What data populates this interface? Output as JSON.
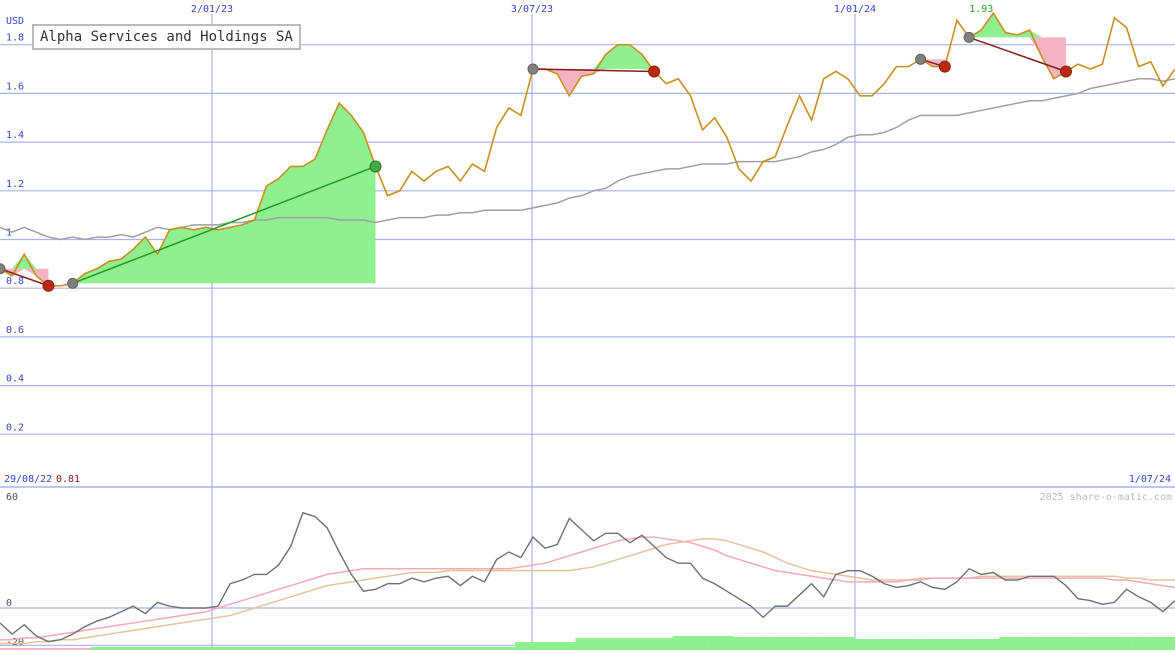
{
  "title": "Alpha Services and Holdings SA",
  "currency": "USD",
  "start_date": "29/08/22",
  "start_price": "0.81",
  "end_date": "1/07/24",
  "peak_label": "1.93",
  "watermark": "2025 share-o-matic.com",
  "colors": {
    "price": "#c8901e",
    "ma": "#a0a0a0",
    "grid": "#a8b4f0",
    "axis_text": "#3344cc",
    "gain_fill": "#90f090",
    "loss_fill": "#f4b4c4",
    "gain_line": "#229922",
    "loss_line": "#8b1a1a",
    "osc": "#707070",
    "osc_pink": "#f4a8b8",
    "osc_tan": "#e4c49c",
    "volume": "#90f090"
  },
  "chart_data": [
    {
      "type": "line",
      "title": "Alpha Services and Holdings SA",
      "ylabel": "USD",
      "ylim": [
        0,
        1.95
      ],
      "y_ticks": [
        "0.2",
        "0.4",
        "0.6",
        "0.8",
        "1",
        "1.2",
        "1.4",
        "1.6",
        "1.8"
      ],
      "x_ticks": [
        "2/01/23",
        "3/07/23",
        "1/01/24"
      ],
      "grid": true,
      "series": [
        {
          "role": "price",
          "values": [
            0.88,
            0.85,
            0.94,
            0.85,
            0.81,
            0.81,
            0.82,
            0.86,
            0.88,
            0.91,
            0.92,
            0.96,
            1.01,
            0.94,
            1.04,
            1.05,
            1.04,
            1.05,
            1.04,
            1.05,
            1.06,
            1.08,
            1.22,
            1.25,
            1.3,
            1.3,
            1.33,
            1.45,
            1.56,
            1.51,
            1.44,
            1.3,
            1.18,
            1.2,
            1.28,
            1.24,
            1.28,
            1.3,
            1.24,
            1.31,
            1.28,
            1.46,
            1.54,
            1.51,
            1.7,
            1.7,
            1.68,
            1.59,
            1.67,
            1.68,
            1.76,
            1.8,
            1.8,
            1.76,
            1.69,
            1.64,
            1.66,
            1.59,
            1.45,
            1.5,
            1.42,
            1.29,
            1.24,
            1.32,
            1.34,
            1.47,
            1.59,
            1.49,
            1.66,
            1.69,
            1.66,
            1.59,
            1.59,
            1.64,
            1.71,
            1.71,
            1.74,
            1.71,
            1.71,
            1.9,
            1.83,
            1.86,
            1.93,
            1.85,
            1.84,
            1.86,
            1.75,
            1.66,
            1.69,
            1.72,
            1.7,
            1.72,
            1.91,
            1.87,
            1.71,
            1.73,
            1.63,
            1.7
          ]
        },
        {
          "role": "moving_average",
          "values": [
            1.05,
            1.03,
            1.05,
            1.03,
            1.01,
            1.0,
            1.01,
            1.0,
            1.01,
            1.01,
            1.02,
            1.01,
            1.03,
            1.05,
            1.04,
            1.05,
            1.06,
            1.06,
            1.06,
            1.07,
            1.07,
            1.08,
            1.08,
            1.09,
            1.09,
            1.09,
            1.09,
            1.09,
            1.08,
            1.08,
            1.08,
            1.07,
            1.08,
            1.09,
            1.09,
            1.09,
            1.1,
            1.1,
            1.11,
            1.11,
            1.12,
            1.12,
            1.12,
            1.12,
            1.13,
            1.14,
            1.15,
            1.17,
            1.18,
            1.2,
            1.21,
            1.24,
            1.26,
            1.27,
            1.28,
            1.29,
            1.29,
            1.3,
            1.31,
            1.31,
            1.31,
            1.32,
            1.32,
            1.32,
            1.32,
            1.33,
            1.34,
            1.36,
            1.37,
            1.39,
            1.42,
            1.43,
            1.43,
            1.44,
            1.46,
            1.49,
            1.51,
            1.51,
            1.51,
            1.51,
            1.52,
            1.53,
            1.54,
            1.55,
            1.56,
            1.57,
            1.57,
            1.58,
            1.59,
            1.6,
            1.62,
            1.63,
            1.64,
            1.65,
            1.66,
            1.66,
            1.65,
            1.66
          ]
        }
      ]
    },
    {
      "type": "line",
      "y_ticks": [
        "-20",
        "0",
        "60"
      ],
      "ylim": [
        -20,
        60
      ],
      "grid": true,
      "series": [
        {
          "role": "oscillator",
          "values": [
            -8,
            -14,
            -9,
            -15,
            -18,
            -17,
            -14,
            -10,
            -7,
            -5,
            -2,
            1,
            -3,
            3,
            1,
            0,
            0,
            0,
            1,
            13,
            15,
            18,
            18,
            23,
            33,
            51,
            49,
            43,
            30,
            18,
            9,
            10,
            13,
            13,
            16,
            14,
            16,
            17,
            12,
            17,
            14,
            26,
            30,
            27,
            38,
            32,
            34,
            48,
            42,
            36,
            40,
            40,
            35,
            39,
            33,
            27,
            24,
            24,
            16,
            13,
            9,
            5,
            1,
            -5,
            1,
            1,
            7,
            13,
            6,
            18,
            20,
            20,
            17,
            13,
            11,
            12,
            14,
            11,
            10,
            14,
            21,
            18,
            19,
            15,
            15,
            17,
            17,
            17,
            12,
            5,
            4,
            2,
            3,
            10,
            6,
            3,
            -2,
            4
          ]
        },
        {
          "role": "signal_pink",
          "values": [
            -17,
            -17,
            -16,
            -16,
            -15,
            -14,
            -13,
            -12,
            -11,
            -10,
            -9,
            -8,
            -7,
            -6,
            -5,
            -4,
            -3,
            -2,
            0,
            2,
            4,
            6,
            8,
            10,
            12,
            14,
            16,
            18,
            19,
            20,
            21,
            21,
            21,
            21,
            21,
            21,
            21,
            21,
            21,
            21,
            21,
            21,
            21,
            22,
            23,
            24,
            26,
            28,
            30,
            32,
            34,
            36,
            37,
            38,
            38,
            37,
            36,
            35,
            33,
            31,
            28,
            26,
            24,
            22,
            20,
            19,
            18,
            17,
            16,
            15,
            14,
            14,
            14,
            14,
            14,
            15,
            15,
            16,
            16,
            16,
            16,
            16,
            16,
            16,
            16,
            16,
            16,
            16,
            16,
            16,
            16,
            16,
            15,
            15,
            14,
            13,
            12,
            11
          ]
        },
        {
          "role": "signal_tan",
          "values": [
            -19,
            -19,
            -19,
            -18,
            -18,
            -17,
            -17,
            -16,
            -15,
            -14,
            -13,
            -12,
            -11,
            -10,
            -9,
            -8,
            -7,
            -6,
            -5,
            -4,
            -2,
            0,
            2,
            4,
            6,
            8,
            10,
            12,
            13,
            14,
            15,
            16,
            17,
            18,
            19,
            19,
            19,
            20,
            20,
            20,
            20,
            20,
            20,
            20,
            20,
            20,
            20,
            20,
            21,
            22,
            24,
            26,
            28,
            30,
            32,
            34,
            35,
            36,
            37,
            37,
            36,
            34,
            32,
            30,
            27,
            24,
            22,
            20,
            19,
            18,
            17,
            16,
            15,
            15,
            15,
            15,
            16,
            16,
            16,
            16,
            16,
            17,
            17,
            17,
            17,
            17,
            17,
            17,
            17,
            17,
            17,
            17,
            17,
            16,
            16,
            15,
            15,
            15
          ]
        }
      ]
    }
  ],
  "trades": [
    {
      "type": "loss",
      "from": 0,
      "to": 4
    },
    {
      "type": "gain",
      "from": 6,
      "to": 31
    },
    {
      "type": "loss",
      "from": 44,
      "to": 54
    },
    {
      "type": "loss",
      "from": 76,
      "to": 78
    },
    {
      "type": "loss",
      "from": 80,
      "to": 88
    }
  ]
}
